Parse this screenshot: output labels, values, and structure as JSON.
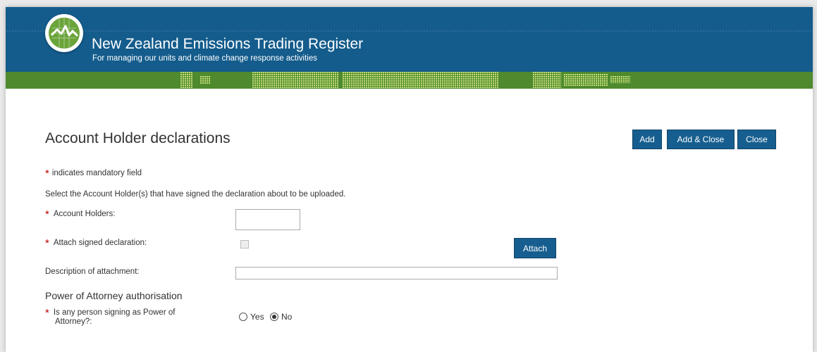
{
  "header": {
    "title": "New Zealand Emissions Trading Register",
    "subtitle": "For managing our units and climate change response activities",
    "logo_icon": "emissions-chart-icon"
  },
  "page": {
    "heading": "Account Holder declarations"
  },
  "actions": {
    "add_label": "Add",
    "add_close_label": "Add & Close",
    "close_label": "Close"
  },
  "form": {
    "mandatory_note": "indicates mandatory field",
    "mandatory_marker": "*",
    "instruction": "Select the Account Holder(s) that have signed the declaration about to be uploaded.",
    "account_holders_label": "Account Holders:",
    "account_holders_value": "",
    "attach_label": "Attach signed declaration:",
    "attach_checked": false,
    "attach_button": "Attach",
    "description_label": "Description of attachment:",
    "description_value": "",
    "poa_section_title": "Power of Attorney authorisation",
    "poa_question_line1": "Is any person signing as Power of",
    "poa_question_line2": "Attorney?:",
    "poa_yes": "Yes",
    "poa_no": "No",
    "poa_selected": "No"
  },
  "colors": {
    "header_blue": "#145c8c",
    "band_green": "#4f8a2f",
    "button_blue": "#165e8f",
    "required_red": "#c00000"
  }
}
